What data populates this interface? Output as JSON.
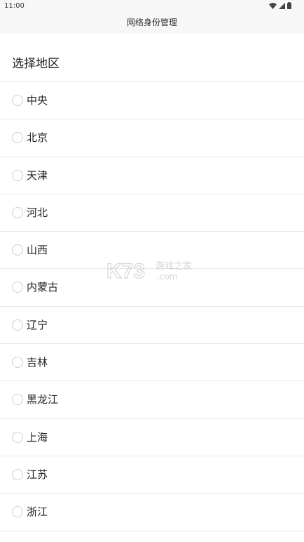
{
  "status_bar": {
    "time": "11:00",
    "icons": [
      "wifi-icon",
      "signal-icon",
      "battery-icon"
    ]
  },
  "header": {
    "title": "网络身份管理"
  },
  "section": {
    "heading": "选择地区"
  },
  "regions": [
    {
      "label": "中央"
    },
    {
      "label": "北京"
    },
    {
      "label": "天津"
    },
    {
      "label": "河北"
    },
    {
      "label": "山西"
    },
    {
      "label": "内蒙古"
    },
    {
      "label": "辽宁"
    },
    {
      "label": "吉林"
    },
    {
      "label": "黑龙江"
    },
    {
      "label": "上海"
    },
    {
      "label": "江苏"
    },
    {
      "label": "浙江"
    }
  ],
  "watermark": {
    "logo_text": "K73",
    "site_text": "游戏之家",
    "domain_text": ".com"
  }
}
